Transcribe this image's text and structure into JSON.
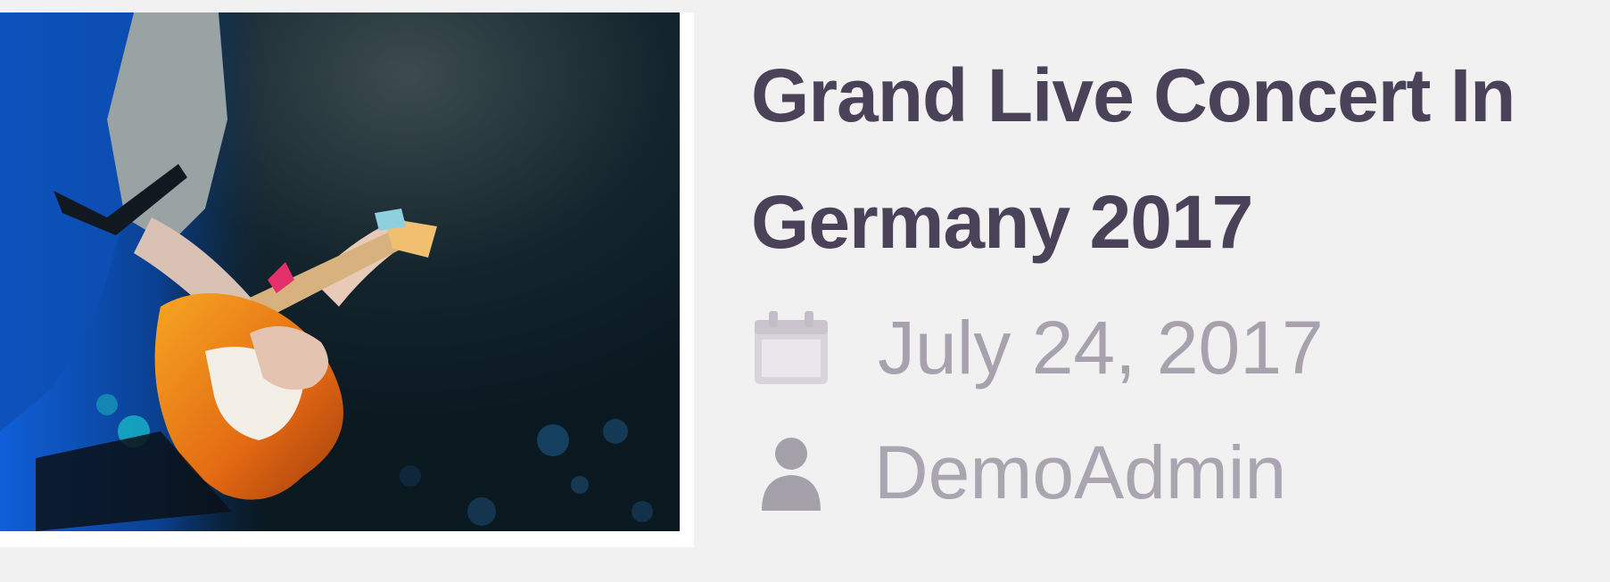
{
  "post": {
    "title": "Grand Live Concert In Germany 2017",
    "date": "July 24, 2017",
    "author": "DemoAdmin",
    "date_icon": "calendar-icon",
    "author_icon": "user-icon",
    "thumbnail": "guitarist-on-stage-photo"
  },
  "colors": {
    "background": "#f1f1f1",
    "title": "#4a4258",
    "meta": "#a7a2ad"
  }
}
